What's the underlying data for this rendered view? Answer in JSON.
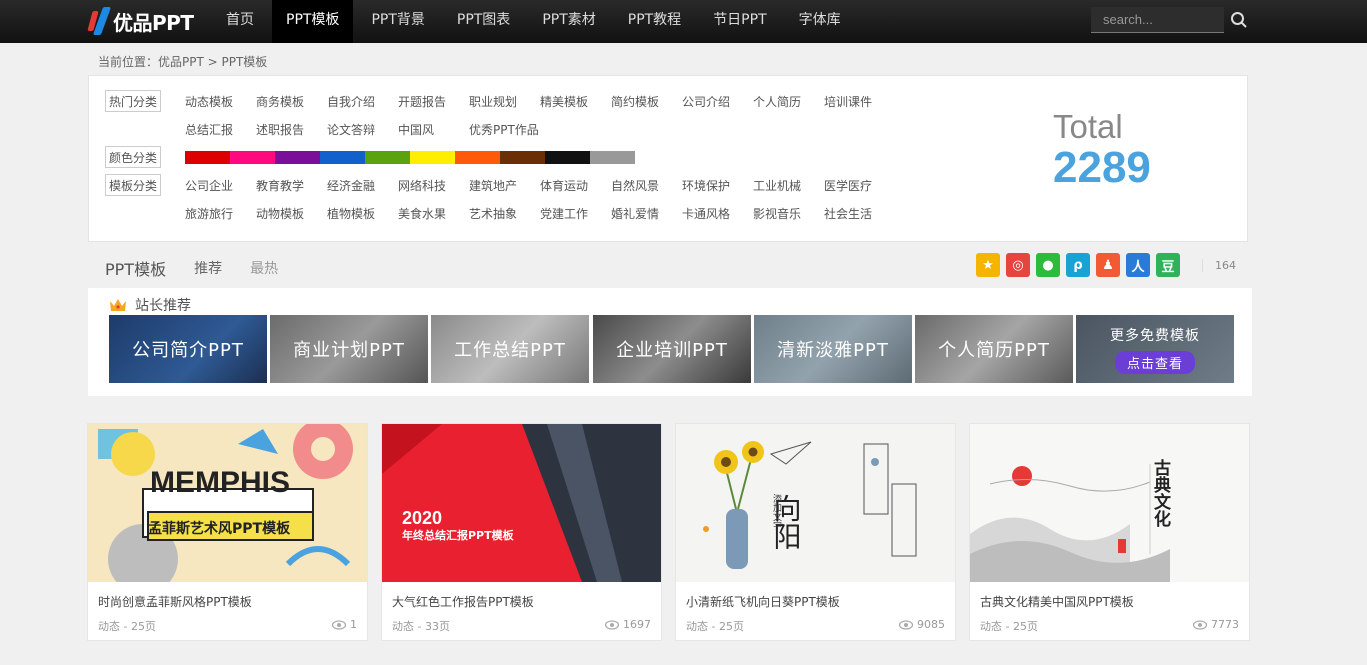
{
  "header": {
    "logo_text": "优品PPT",
    "nav": [
      "首页",
      "PPT模板",
      "PPT背景",
      "PPT图表",
      "PPT素材",
      "PPT教程",
      "节日PPT",
      "字体库"
    ],
    "active_index": 1,
    "search_placeholder": "search..."
  },
  "breadcrumb": "当前位置：优品PPT > PPT模板",
  "filter": {
    "hot_label": "热门分类",
    "hot_row1": [
      "动态模板",
      "商务模板",
      "自我介绍",
      "开题报告",
      "职业规划",
      "精美模板",
      "简约模板",
      "公司介绍",
      "个人简历",
      "培训课件"
    ],
    "hot_row2": [
      "总结汇报",
      "述职报告",
      "论文答辩",
      "中国风",
      "优秀PPT作品"
    ],
    "color_label": "颜色分类",
    "colors": [
      "#dd0000",
      "#ff0a7e",
      "#7a109a",
      "#1260cc",
      "#5aa30e",
      "#ffee00",
      "#ff5a0a",
      "#6b2f06",
      "#111111",
      "#999999"
    ],
    "template_label": "模板分类",
    "tpl_row1": [
      "公司企业",
      "教育教学",
      "经济金融",
      "网络科技",
      "建筑地产",
      "体育运动",
      "自然风景",
      "环境保护",
      "工业机械",
      "医学医疗"
    ],
    "tpl_row2": [
      "旅游旅行",
      "动物模板",
      "植物模板",
      "美食水果",
      "艺术抽象",
      "党建工作",
      "婚礼爱情",
      "卡通风格",
      "影视音乐",
      "社会生活"
    ],
    "total_label": "Total",
    "total_value": "2289"
  },
  "tabs": {
    "title": "PPT模板",
    "recommend": "推荐",
    "hottest": "最热"
  },
  "share": {
    "icons": [
      "qzone-icon",
      "weibo-icon",
      "wechat-icon",
      "tencent-weibo-icon",
      "qq-icon",
      "renren-icon",
      "douban-icon"
    ],
    "count": "164"
  },
  "recommend": {
    "title": "站长推荐",
    "banners": [
      "公司简介PPT",
      "商业计划PPT",
      "工作总结PPT",
      "企业培训PPT",
      "清新淡雅PPT",
      "个人简历PPT"
    ],
    "more_text": "更多免费模板",
    "more_button": "点击查看"
  },
  "cards": [
    {
      "title": "时尚创意孟菲斯风格PPT模板",
      "meta": "动态 - 25页",
      "views": "1",
      "thumb_headline": "MEMPHIS",
      "thumb_sub": "孟菲斯艺术风PPT模板"
    },
    {
      "title": "大气红色工作报告PPT模板",
      "meta": "动态 - 33页",
      "views": "1697",
      "thumb_headline": "2020",
      "thumb_sub": "年终总结汇报PPT模板"
    },
    {
      "title": "小清新纸飞机向日葵PPT模板",
      "meta": "动态 - 25页",
      "views": "9085",
      "thumb_headline": "向阳",
      "thumb_sub": "添加文字"
    },
    {
      "title": "古典文化精美中国风PPT模板",
      "meta": "动态 - 25页",
      "views": "7773",
      "thumb_headline": "古典文化",
      "thumb_sub": ""
    }
  ]
}
